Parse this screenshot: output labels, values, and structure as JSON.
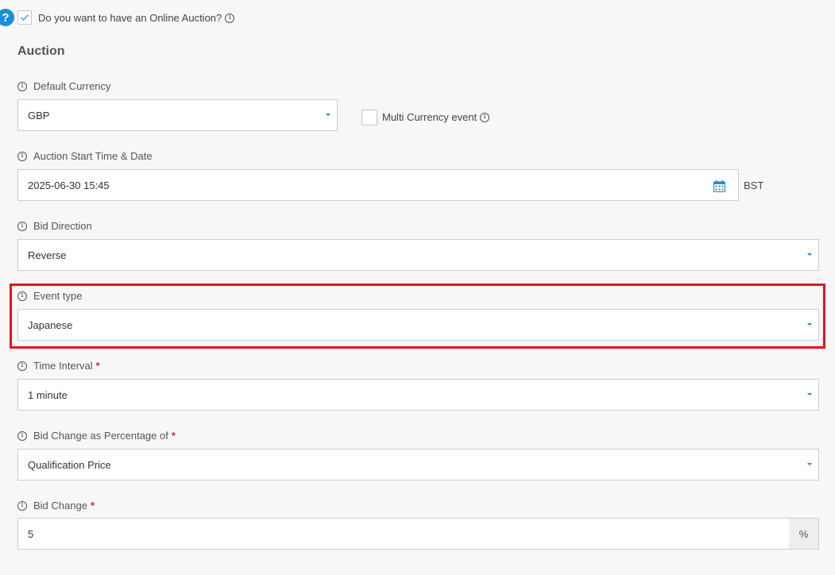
{
  "online_auction": {
    "question": "Do you want to have an Online Auction?",
    "checked": true
  },
  "section": {
    "title": "Auction"
  },
  "default_currency": {
    "label": "Default Currency",
    "value": "GBP"
  },
  "multi_currency": {
    "label": "Multi Currency event",
    "checked": false
  },
  "start_time": {
    "label": "Auction Start Time & Date",
    "value": "2025-06-30 15:45",
    "timezone": "BST"
  },
  "bid_direction": {
    "label": "Bid Direction",
    "value": "Reverse"
  },
  "event_type": {
    "label": "Event type",
    "value": "Japanese"
  },
  "time_interval": {
    "label": "Time Interval",
    "required_mark": "*",
    "value": "1 minute"
  },
  "bid_change_pct": {
    "label": "Bid Change as Percentage of",
    "required_mark": "*",
    "value": "Qualification Price"
  },
  "bid_change": {
    "label": "Bid Change",
    "required_mark": "*",
    "value": "5",
    "unit": "%"
  },
  "help_icon": {
    "glyph": "?"
  },
  "info_icon": {
    "glyph": "i"
  },
  "colors": {
    "accent": "#1b8fd6",
    "highlight": "#e3131f",
    "required": "#d9252c"
  }
}
